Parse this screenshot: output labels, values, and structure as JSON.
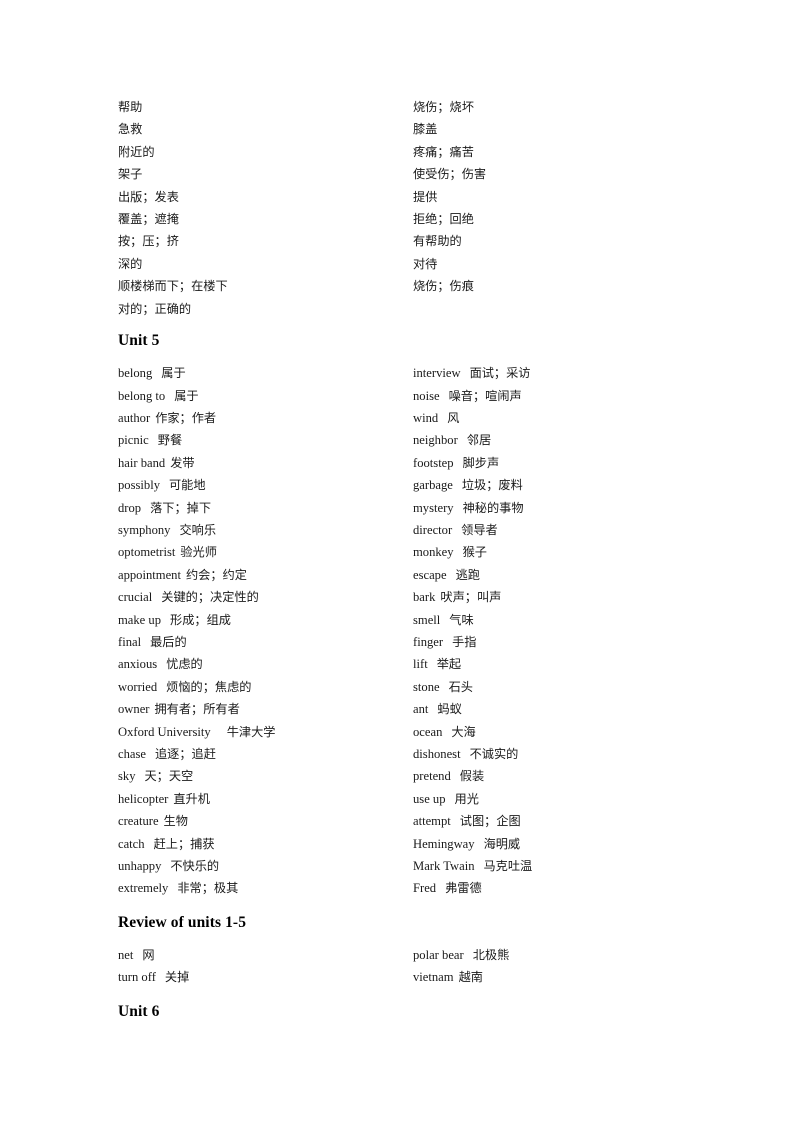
{
  "document": {
    "type": "vocabulary-list",
    "page_background": "#ffffff",
    "text_color": "#000000"
  },
  "sections": [
    {
      "id": "unit-4-continued",
      "heading": null,
      "entries": [
        {
          "left_en": "",
          "left_zh": "帮助",
          "right_en": "",
          "right_zh": "烧伤；烧坏"
        },
        {
          "left_en": "",
          "left_zh": "急救",
          "right_en": "",
          "right_zh": "膝盖"
        },
        {
          "left_en": "",
          "left_zh": "附近的",
          "right_en": "",
          "right_zh": "疼痛；痛苦"
        },
        {
          "left_en": "",
          "left_zh": "架子",
          "right_en": "",
          "right_zh": "使受伤；伤害"
        },
        {
          "left_en": "",
          "left_zh": "出版；发表",
          "right_en": "",
          "right_zh": "提供"
        },
        {
          "left_en": "",
          "left_zh": "覆盖；遮掩",
          "right_en": "",
          "right_zh": "拒绝；回绝"
        },
        {
          "left_en": "",
          "left_zh": "按；压；挤",
          "right_en": "",
          "right_zh": "有帮助的"
        },
        {
          "left_en": "",
          "left_zh": "深的",
          "right_en": "",
          "right_zh": "对待"
        },
        {
          "left_en": "",
          "left_zh": "顺楼梯而下；在楼下",
          "right_en": "",
          "right_zh": "烧伤；伤痕"
        },
        {
          "left_en": "",
          "left_zh": "对的；正确的",
          "right_en": "",
          "right_zh": ""
        }
      ]
    },
    {
      "id": "unit-5",
      "heading": "Unit 5",
      "entries": [
        {
          "left_en": "belong",
          "left_zh": "属于",
          "right_en": "interview",
          "right_zh": "面试；采访"
        },
        {
          "left_en": "belong to",
          "left_zh": "属于",
          "right_en": "noise",
          "right_zh": "噪音；喧闹声"
        },
        {
          "left_en": "author",
          "left_zh": "作家；作者",
          "right_en": "wind",
          "right_zh": "风"
        },
        {
          "left_en": "picnic",
          "left_zh": "野餐",
          "right_en": "neighbor",
          "right_zh": "邻居"
        },
        {
          "left_en": "hair band",
          "left_zh": "发带",
          "right_en": "footstep",
          "right_zh": "脚步声"
        },
        {
          "left_en": "possibly",
          "left_zh": "可能地",
          "right_en": "garbage",
          "right_zh": "垃圾；废料"
        },
        {
          "left_en": "drop",
          "left_zh": "落下；掉下",
          "right_en": "mystery",
          "right_zh": "神秘的事物"
        },
        {
          "left_en": "symphony",
          "left_zh": "交响乐",
          "right_en": "director",
          "right_zh": "领导者"
        },
        {
          "left_en": "optometrist",
          "left_zh": "验光师",
          "right_en": "monkey",
          "right_zh": "猴子"
        },
        {
          "left_en": "appointment",
          "left_zh": "约会；约定",
          "right_en": "escape",
          "right_zh": "逃跑"
        },
        {
          "left_en": "crucial",
          "left_zh": "关键的；决定性的",
          "right_en": "bark",
          "right_zh": "吠声；叫声"
        },
        {
          "left_en": "make up",
          "left_zh": "形成；组成",
          "right_en": "smell",
          "right_zh": "气味"
        },
        {
          "left_en": "final",
          "left_zh": "最后的",
          "right_en": "finger",
          "right_zh": "手指"
        },
        {
          "left_en": "anxious",
          "left_zh": "忧虑的",
          "right_en": "lift",
          "right_zh": "举起"
        },
        {
          "left_en": "worried",
          "left_zh": "烦恼的；焦虑的",
          "right_en": "stone",
          "right_zh": "石头"
        },
        {
          "left_en": "owner",
          "left_zh": "拥有者；所有者",
          "right_en": "ant",
          "right_zh": "蚂蚁"
        },
        {
          "left_en": "Oxford University",
          "left_zh": "牛津大学",
          "right_en": "ocean",
          "right_zh": "大海"
        },
        {
          "left_en": "chase",
          "left_zh": "追逐；追赶",
          "right_en": "dishonest",
          "right_zh": "不诚实的"
        },
        {
          "left_en": "sky",
          "left_zh": "天；天空",
          "right_en": "pretend",
          "right_zh": "假装"
        },
        {
          "left_en": "helicopter",
          "left_zh": "直升机",
          "right_en": "use up",
          "right_zh": "用光"
        },
        {
          "left_en": "creature",
          "left_zh": "生物",
          "right_en": "attempt",
          "right_zh": "试图；企图"
        },
        {
          "left_en": "catch",
          "left_zh": "赶上；捕获",
          "right_en": "Hemingway",
          "right_zh": "海明威"
        },
        {
          "left_en": "unhappy",
          "left_zh": "不快乐的",
          "right_en": "Mark Twain",
          "right_zh": "马克吐温"
        },
        {
          "left_en": "extremely",
          "left_zh": "非常；极其",
          "right_en": "Fred",
          "right_zh": "弗雷德"
        }
      ]
    },
    {
      "id": "review-units-1-5",
      "heading": "Review of units 1-5",
      "entries": [
        {
          "left_en": "net",
          "left_zh": "网",
          "right_en": "polar bear",
          "right_zh": "北极熊"
        },
        {
          "left_en": "turn off",
          "left_zh": "关掉",
          "right_en": "vietnam",
          "right_zh": "越南"
        }
      ]
    },
    {
      "id": "unit-6",
      "heading": "Unit 6",
      "entries": []
    }
  ]
}
